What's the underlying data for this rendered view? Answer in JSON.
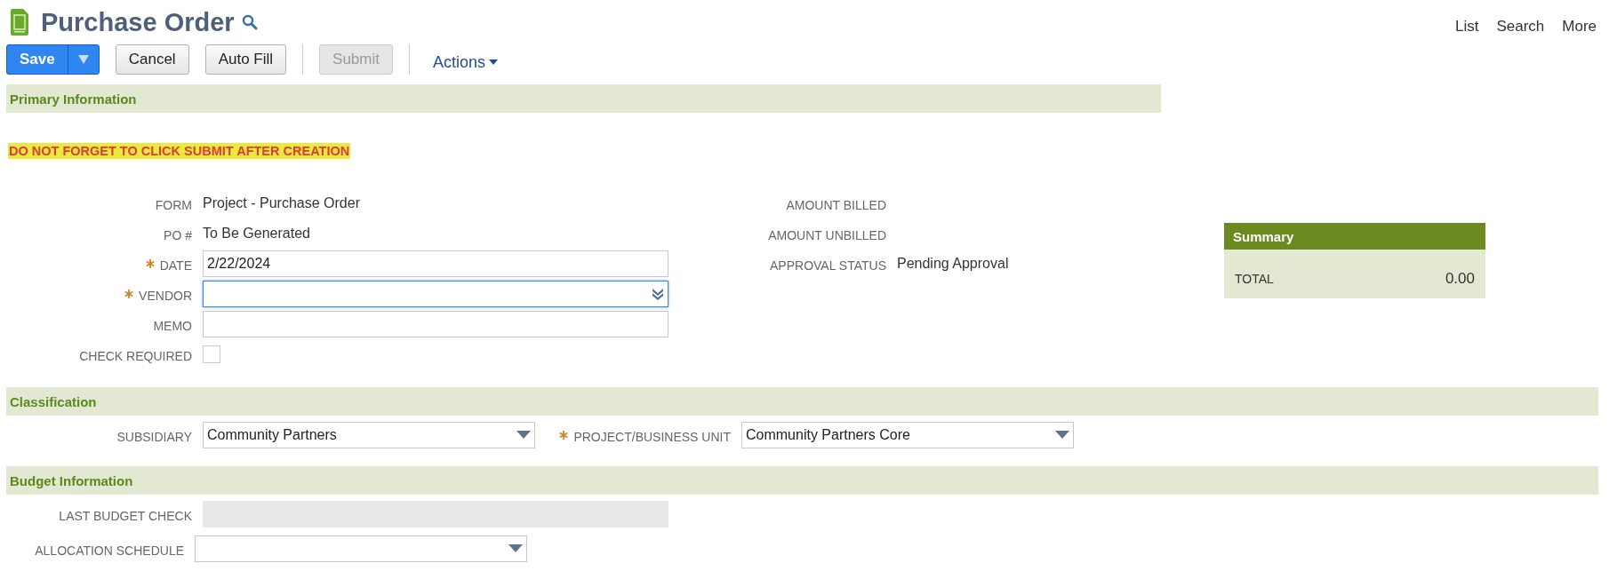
{
  "header": {
    "title": "Purchase Order",
    "links": [
      "List",
      "Search",
      "More"
    ]
  },
  "toolbar": {
    "buttons": [
      {
        "label": "Save",
        "kind": "split",
        "disabled": false
      },
      {
        "label": "Cancel",
        "kind": "plain",
        "disabled": false
      },
      {
        "label": "Auto Fill",
        "kind": "plain",
        "disabled": false
      },
      {
        "label": "Submit",
        "kind": "plain",
        "disabled": true
      }
    ],
    "actions": "Actions"
  },
  "primary": {
    "title": "Primary Information",
    "notice": "DO NOT FORGET TO CLICK SUBMIT AFTER CREATION",
    "left_fields": [
      {
        "label": "FORM",
        "kind": "text",
        "value": "Project - Purchase Order",
        "required": false
      },
      {
        "label": "PO #",
        "kind": "text",
        "value": "To Be Generated",
        "required": false
      },
      {
        "label": "DATE",
        "kind": "input",
        "value": "2/22/2024",
        "required": true,
        "focused": false
      },
      {
        "label": "VENDOR",
        "kind": "combobox",
        "required": true,
        "focused": true
      },
      {
        "label": "MEMO",
        "kind": "input",
        "required": false,
        "focused": false
      },
      {
        "label": "CHECK REQUIRED",
        "kind": "checkbox",
        "required": false,
        "checked": false
      }
    ],
    "right_fields": [
      {
        "label": "AMOUNT BILLED",
        "kind": "text",
        "required": false
      },
      {
        "label": "AMOUNT UNBILLED",
        "kind": "text",
        "required": false
      },
      {
        "label": "APPROVAL STATUS",
        "kind": "text",
        "value": "Pending Approval",
        "required": false
      }
    ],
    "summary": {
      "title": "Summary",
      "label": "TOTAL",
      "value": "0.00"
    }
  },
  "classification": {
    "title": "Classification",
    "fields": [
      {
        "label": "SUBSIDIARY",
        "kind": "select",
        "value": "Community Partners",
        "required": false,
        "focused": false
      },
      {
        "label": "PROJECT/BUSINESS UNIT",
        "kind": "select",
        "value": "Community Partners Core",
        "required": true,
        "focused": false
      }
    ]
  },
  "budget": {
    "title": "Budget Information",
    "fields": [
      {
        "label": "LAST BUDGET CHECK",
        "kind": "readonly",
        "required": false,
        "focused": false
      },
      {
        "label": "ALLOCATION SCHEDULE",
        "kind": "select",
        "required": false,
        "focused": false
      }
    ]
  }
}
